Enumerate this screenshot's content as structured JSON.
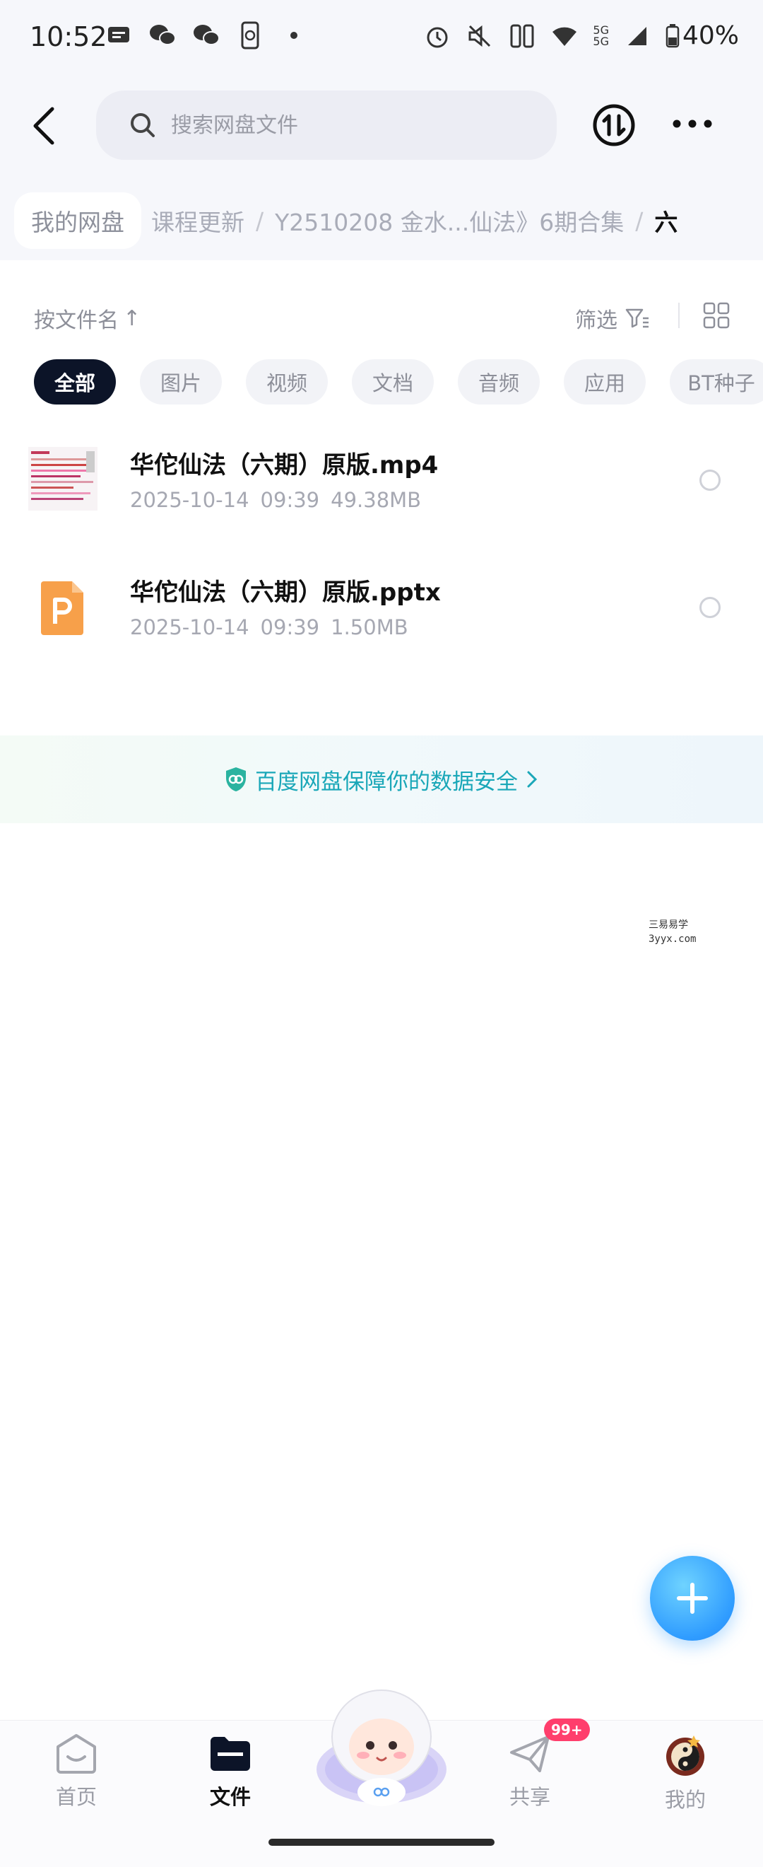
{
  "status_bar": {
    "time": "10:52",
    "network_label": "5G",
    "battery": "40%",
    "icons_left": [
      "message-icon",
      "wechat-icon",
      "wechat-icon",
      "phone-sync-icon",
      "dot-icon"
    ],
    "icons_right": [
      "alarm-icon",
      "mute-icon",
      "nfc-icon",
      "wifi-icon",
      "signal-icon",
      "battery-icon"
    ]
  },
  "header": {
    "search_placeholder": "搜索网盘文件"
  },
  "breadcrumb": {
    "root": "我的网盘",
    "items": [
      "课程更新",
      "Y2510208 金水...仙法》6期合集"
    ],
    "current": "六"
  },
  "toolbar": {
    "sort_label": "按文件名",
    "sort_arrow": "↑",
    "filter_label": "筛选"
  },
  "chips": [
    {
      "label": "全部",
      "active": true
    },
    {
      "label": "图片",
      "active": false
    },
    {
      "label": "视频",
      "active": false
    },
    {
      "label": "文档",
      "active": false
    },
    {
      "label": "音频",
      "active": false
    },
    {
      "label": "应用",
      "active": false
    },
    {
      "label": "BT种子",
      "active": false
    }
  ],
  "files": [
    {
      "name": "华佗仙法（六期）原版.mp4",
      "date": "2025-10-14",
      "time": "09:39",
      "size": "49.38MB",
      "icon": "video-thumbnail"
    },
    {
      "name": "华佗仙法（六期）原版.pptx",
      "date": "2025-10-14",
      "time": "09:39",
      "size": "1.50MB",
      "icon": "pptx-icon"
    }
  ],
  "safety_banner": {
    "text": "百度网盘保障你的数据安全"
  },
  "watermark": {
    "line1": "三易易学",
    "line2": "3yyx.com"
  },
  "bottom_nav": {
    "items": [
      {
        "label": "首页",
        "active": false,
        "icon": "home-icon"
      },
      {
        "label": "文件",
        "active": true,
        "icon": "folder-icon"
      },
      {
        "label": "共享",
        "active": false,
        "icon": "share-icon"
      },
      {
        "label": "我的",
        "active": false,
        "icon": "avatar-icon"
      }
    ],
    "share_badge": "99+"
  },
  "colors": {
    "accent": "#2f9cff",
    "chip_active": "#0c1428",
    "safety_text": "#1aa7b8",
    "badge": "#ff3e6c"
  }
}
